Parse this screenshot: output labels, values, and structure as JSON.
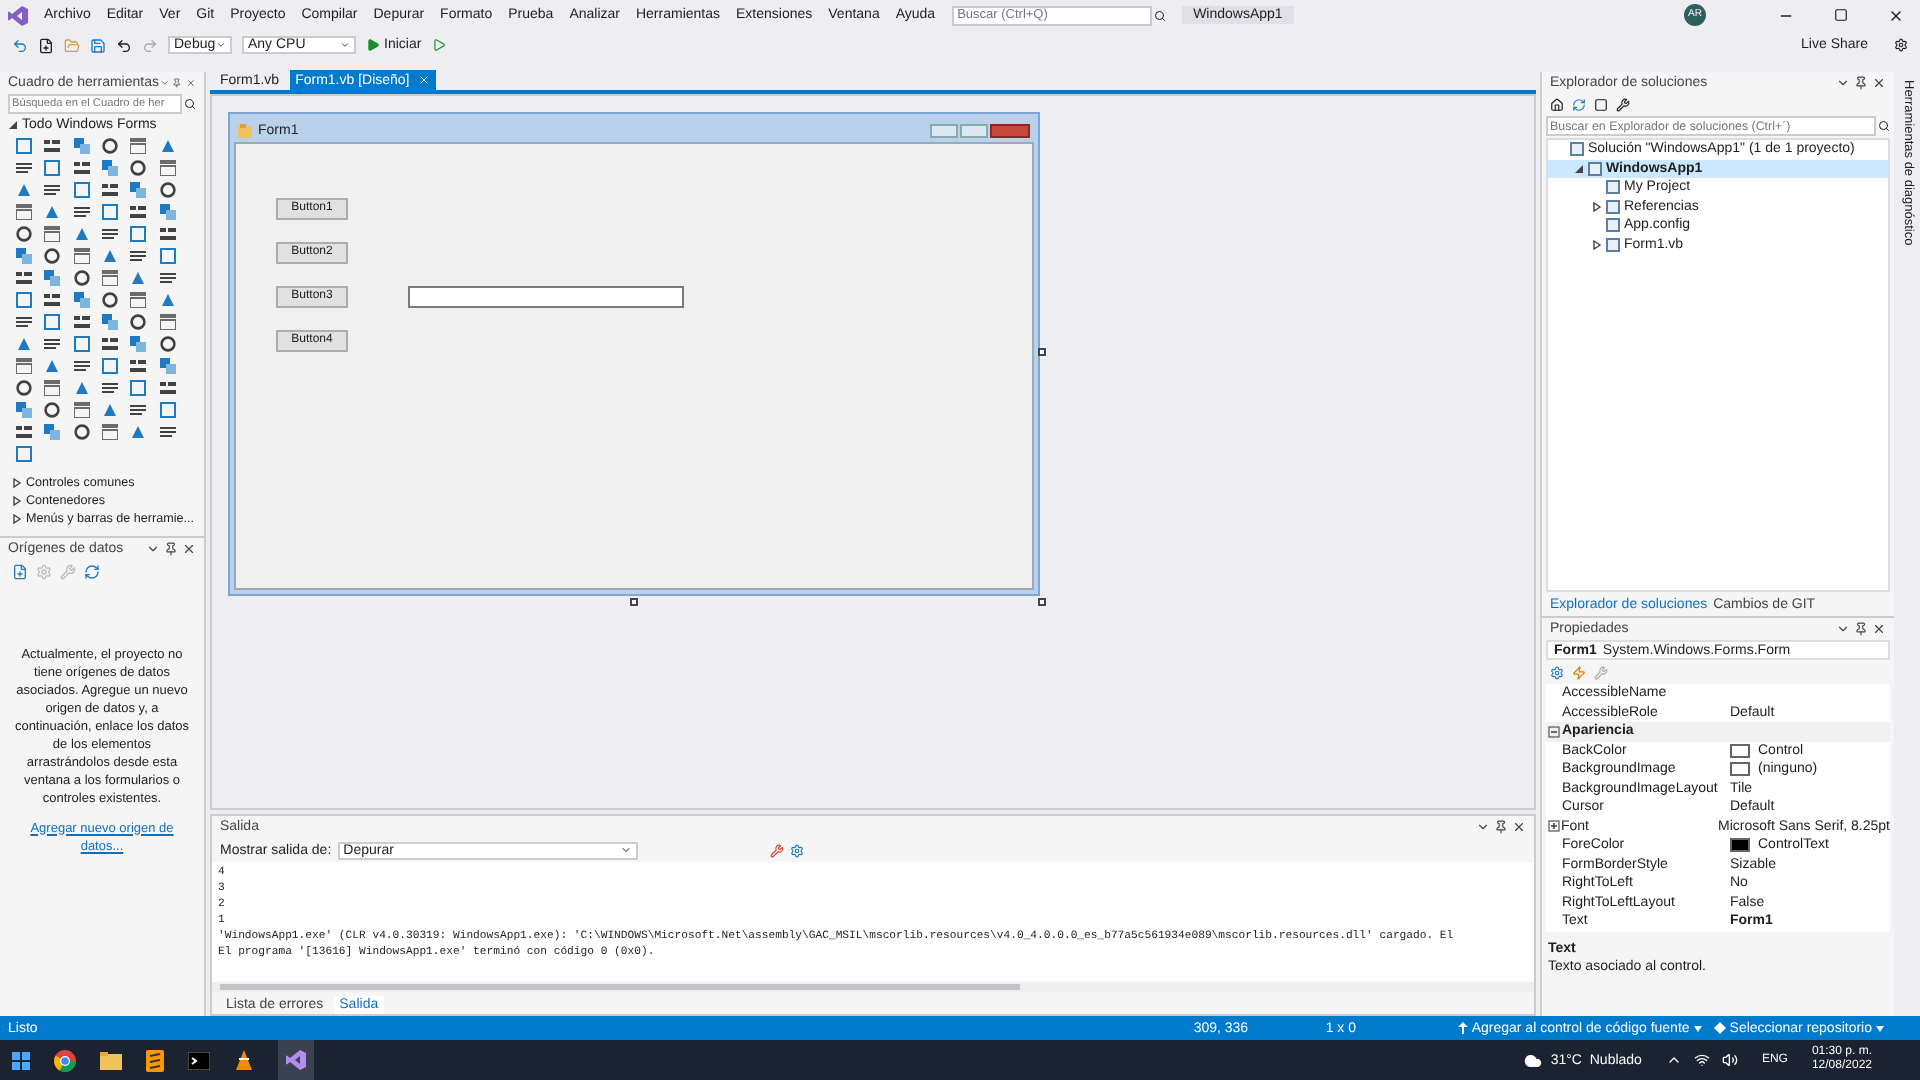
{
  "menu": [
    "Archivo",
    "Editar",
    "Ver",
    "Git",
    "Proyecto",
    "Compilar",
    "Depurar",
    "Formato",
    "Prueba",
    "Analizar",
    "Herramientas",
    "Extensiones",
    "Ventana",
    "Ayuda"
  ],
  "search": {
    "placeholder": "Buscar (Ctrl+Q)"
  },
  "solution_name": "WindowsApp1",
  "avatar": "AR",
  "toolbar": {
    "configuration": "Debug",
    "platform": "Any CPU",
    "start": "Iniciar",
    "live_share": "Live Share"
  },
  "toolbox": {
    "title": "Cuadro de herramientas",
    "search": {
      "placeholder": "Búsqueda en el Cuadro de her"
    },
    "group": "Todo Windows Forms",
    "groups": [
      "Controles comunes",
      "Contenedores",
      "Menús y barras de herramie..."
    ]
  },
  "data_sources": {
    "title": "Orígenes de datos",
    "message": "Actualmente, el proyecto no tiene orígenes de datos asociados. Agregue un nuevo origen de datos y, a continuación, enlace los datos de los elementos arrastrándolos desde esta ventana a los formularios o controles existentes.",
    "link": "Agregar nuevo origen de datos..."
  },
  "doc_tabs": [
    {
      "label": "Form1.vb",
      "selected": false
    },
    {
      "label": "Form1.vb [Diseño]",
      "selected": true
    }
  ],
  "form": {
    "title": "Form1",
    "buttons": [
      "Button1",
      "Button2",
      "Button3",
      "Button4"
    ]
  },
  "output": {
    "title": "Salida",
    "source_label": "Mostrar salida de:",
    "source": "Depurar",
    "lines": [
      "4",
      "3",
      "2",
      "1",
      "'WindowsApp1.exe' (CLR v4.0.30319: WindowsApp1.exe): 'C:\\WINDOWS\\Microsoft.Net\\assembly\\GAC_MSIL\\mscorlib.resources\\v4.0_4.0.0.0_es_b77a5c561934e089\\mscorlib.resources.dll' cargado. El",
      "El programa '[13616] WindowsApp1.exe' terminó con código 0 (0x0)."
    ],
    "tabs": [
      {
        "label": "Lista de errores",
        "selected": false
      },
      {
        "label": "Salida",
        "selected": true
      }
    ]
  },
  "solution_explorer": {
    "title": "Explorador de soluciones",
    "search": {
      "placeholder": "Buscar en Explorador de soluciones (Ctrl+´)"
    },
    "tree": [
      {
        "label": "Solución \"WindowsApp1\" (1 de 1 proyecto)",
        "selected": false,
        "children": [
          {
            "label": "WindowsApp1",
            "expanded": true,
            "selected": true,
            "children": [
              {
                "label": "My Project",
                "selected": false
              },
              {
                "label": "Referencias",
                "expanded": false,
                "selected": false
              },
              {
                "label": "App.config",
                "selected": false
              },
              {
                "label": "Form1.vb",
                "expanded": false,
                "selected": false
              }
            ]
          }
        ]
      }
    ],
    "tabs": [
      {
        "label": "Explorador de soluciones",
        "selected": true
      },
      {
        "label": "Cambios de GIT",
        "selected": false
      }
    ]
  },
  "properties": {
    "title": "Propiedades",
    "object": "Form1",
    "type": "System.Windows.Forms.Form",
    "rows": [
      {
        "kind": "property",
        "name": "AccessibleName",
        "value": ""
      },
      {
        "kind": "property",
        "name": "AccessibleRole",
        "value": "Default"
      },
      {
        "kind": "category",
        "name": "Apariencia",
        "expanded": true
      },
      {
        "kind": "property",
        "name": "BackColor",
        "value": "Control",
        "color": "#ffffff"
      },
      {
        "kind": "property",
        "name": "BackgroundImage",
        "value": "(ninguno)",
        "color": "#ffffff"
      },
      {
        "kind": "property",
        "name": "BackgroundImageLayout",
        "value": "Tile"
      },
      {
        "kind": "property",
        "name": "Cursor",
        "value": "Default"
      },
      {
        "kind": "property",
        "name": "Font",
        "value": "Microsoft Sans Serif, 8.25pt",
        "expanded": false
      },
      {
        "kind": "property",
        "name": "ForeColor",
        "value": "ControlText",
        "color": "#000000"
      },
      {
        "kind": "property",
        "name": "FormBorderStyle",
        "value": "Sizable"
      },
      {
        "kind": "property",
        "name": "RightToLeft",
        "value": "No"
      },
      {
        "kind": "property",
        "name": "RightToLeftLayout",
        "value": "False"
      },
      {
        "kind": "property",
        "name": "Text",
        "value": "Form1",
        "modified": true
      }
    ],
    "description": {
      "title": "Text",
      "text": "Texto asociado al control."
    }
  },
  "side_strip": "Herramientas de diagnóstico",
  "status": {
    "text": "Listo",
    "position": "309, 336",
    "size": "1 x 0",
    "source_control": "Agregar al control de código fuente",
    "repository": "Seleccionar repositorio"
  },
  "taskbar": {
    "weather": "31°C  Nublado",
    "language": "ENG",
    "time": "01:30 p. m.",
    "date": "12/08/2022"
  }
}
